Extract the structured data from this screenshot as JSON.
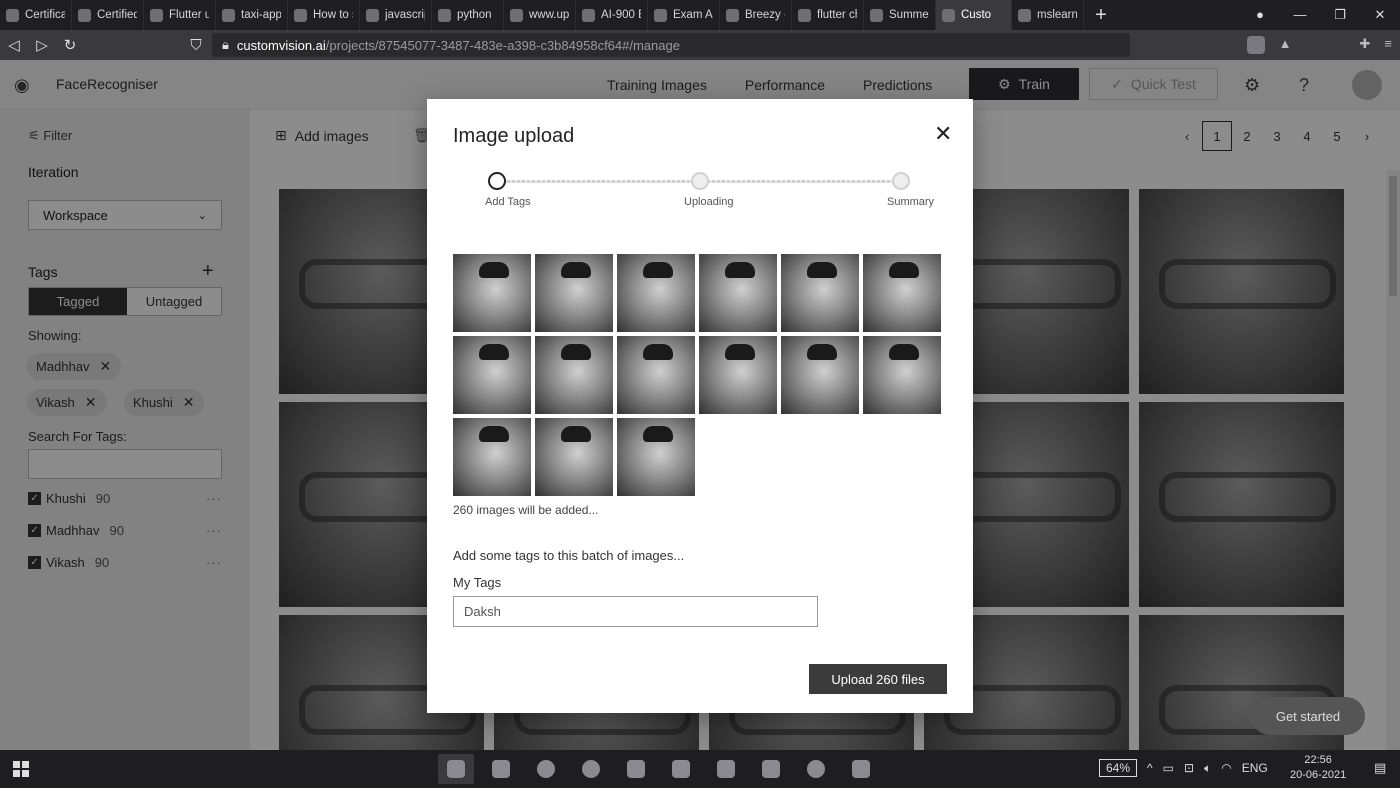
{
  "browser": {
    "tabs": [
      {
        "label": "Certificat"
      },
      {
        "label": "Certified"
      },
      {
        "label": "Flutter ui"
      },
      {
        "label": "taxi-app"
      },
      {
        "label": "How to s"
      },
      {
        "label": "javascrip"
      },
      {
        "label": "python"
      },
      {
        "label": "www.upv"
      },
      {
        "label": "AI-900 Ex"
      },
      {
        "label": "Exam AI-"
      },
      {
        "label": "Breezy -"
      },
      {
        "label": "flutter ch"
      },
      {
        "label": "Summer"
      },
      {
        "label": "Custo"
      },
      {
        "label": "mslearn-"
      }
    ],
    "url_host": "customvision.ai",
    "url_path": "/projects/87545077-3487-483e-a398-c3b84958cf64#/manage"
  },
  "app": {
    "project_name": "FaceRecogniser",
    "nav": [
      "Training Images",
      "Performance",
      "Predictions"
    ],
    "train_label": "Train",
    "quick_test_label": "Quick Test"
  },
  "sidebar": {
    "filter_label": "Filter",
    "iteration_heading": "Iteration",
    "iteration_value": "Workspace",
    "tags_heading": "Tags",
    "tagged_label": "Tagged",
    "untagged_label": "Untagged",
    "showing_label": "Showing:",
    "chips": [
      "Madhhav",
      "Vikash",
      "Khushi"
    ],
    "search_label": "Search For Tags:",
    "tag_list": [
      {
        "name": "Khushi",
        "count": "90"
      },
      {
        "name": "Madhhav",
        "count": "90"
      },
      {
        "name": "Vikash",
        "count": "90"
      }
    ]
  },
  "main": {
    "add_images_label": "Add images",
    "pages": [
      "1",
      "2",
      "3",
      "4",
      "5"
    ],
    "current_page": "1"
  },
  "modal": {
    "title": "Image upload",
    "steps": [
      "Add Tags",
      "Uploading",
      "Summary"
    ],
    "note": "260 images will be added...",
    "subheading": "Add some tags to this batch of images...",
    "my_tags_label": "My Tags",
    "tag_input_value": "Daksh",
    "upload_label": "Upload 260 files"
  },
  "get_started_label": "Get started",
  "taskbar": {
    "battery": "64%",
    "language": "ENG",
    "time": "22:56",
    "date": "20-06-2021"
  },
  "colors": {
    "overlay": "#000000",
    "primary_button": "#3b3b3b"
  }
}
